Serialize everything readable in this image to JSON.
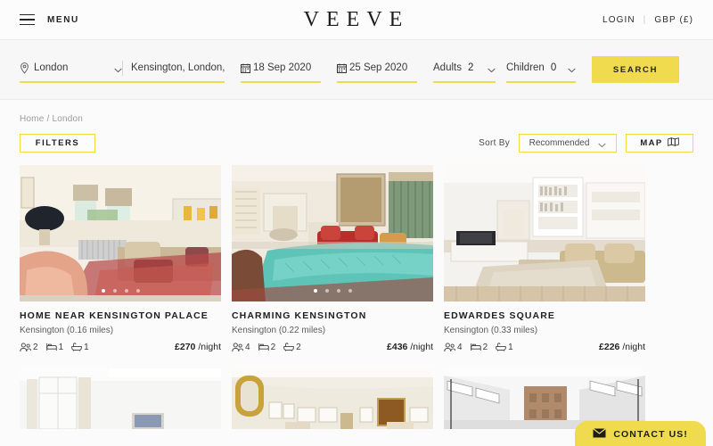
{
  "nav": {
    "menu_label": "MENU",
    "brand": "VEEVE",
    "login_label": "LOGIN",
    "separator": "|",
    "currency_label": "GBP (£)"
  },
  "search": {
    "location_city": "London",
    "location_area": "Kensington, London,",
    "checkin": "18 Sep 2020",
    "checkout": "25 Sep 2020",
    "adults_label": "Adults",
    "adults_value": "2",
    "children_label": "Children",
    "children_value": "0",
    "search_button": "SEARCH"
  },
  "breadcrumb": {
    "home": "Home",
    "slash": "/",
    "current": "London"
  },
  "controls": {
    "filters_label": "FILTERS",
    "sort_by_label": "Sort By",
    "sort_value": "Recommended",
    "map_label": "MAP"
  },
  "cards": [
    {
      "title": "HOME NEAR KENSINGTON PALACE",
      "subtitle": "Kensington (0.16 miles)",
      "guests": "2",
      "bedrooms": "1",
      "bathrooms": "1",
      "price": "£270",
      "price_unit": "/night",
      "dots": 4,
      "active_dot": 0
    },
    {
      "title": "CHARMING KENSINGTON",
      "subtitle": "Kensington (0.22 miles)",
      "guests": "4",
      "bedrooms": "2",
      "bathrooms": "2",
      "price": "£436",
      "price_unit": "/night",
      "dots": 4,
      "active_dot": 0
    },
    {
      "title": "EDWARDES SQUARE",
      "subtitle": "Kensington (0.33 miles)",
      "guests": "4",
      "bedrooms": "2",
      "bathrooms": "1",
      "price": "£226",
      "price_unit": "/night",
      "dots": 0,
      "active_dot": -1
    }
  ],
  "contact": {
    "label": "CONTACT US!"
  },
  "colors": {
    "accent_yellow": "#f0db4f",
    "page_background": "#fbfbfb",
    "searchbar_background": "#f7f7f7",
    "text_primary": "#202020",
    "text_muted": "#9a9a9a"
  }
}
